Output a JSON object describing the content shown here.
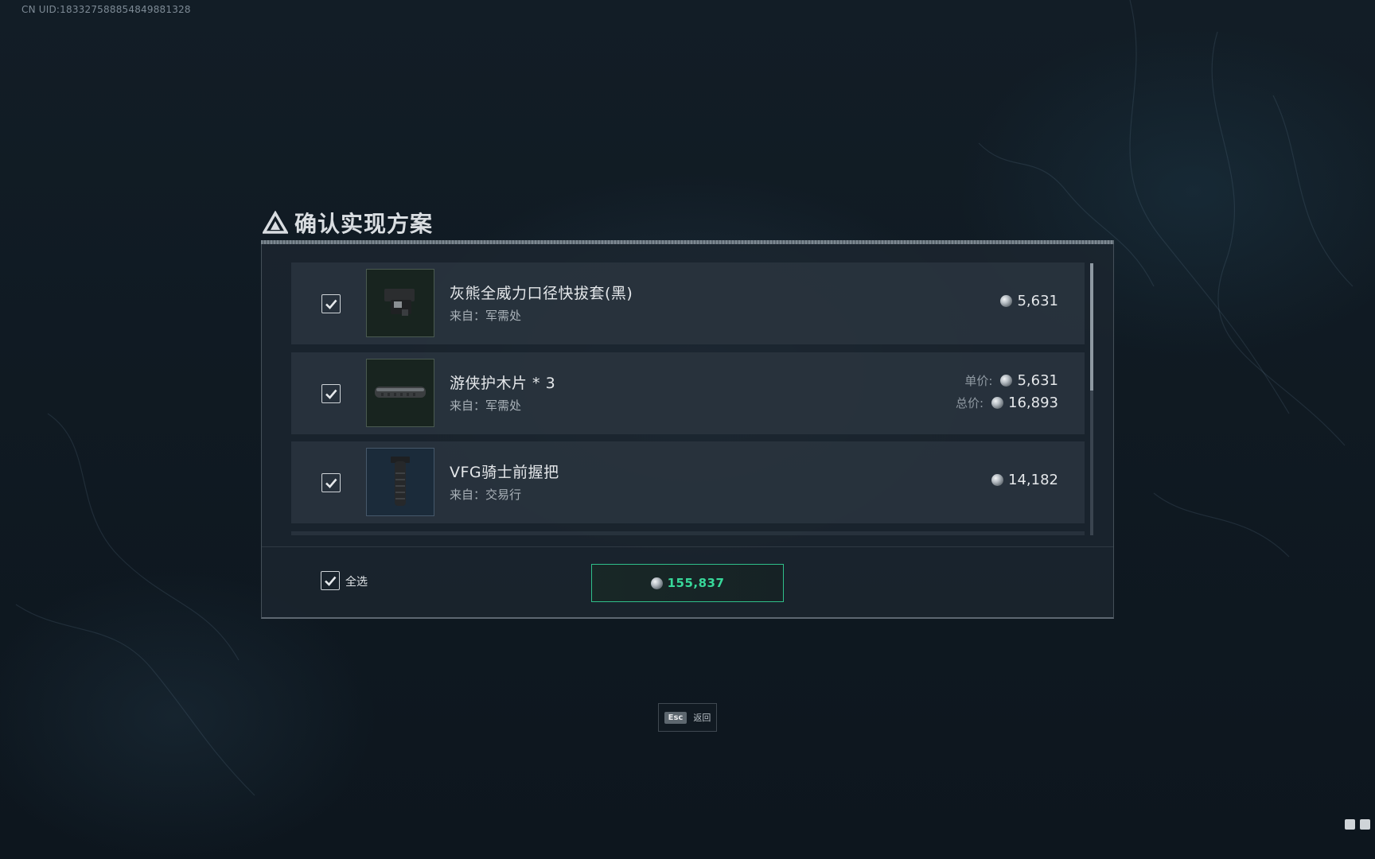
{
  "uid_text": "CN UID:1833275888548498​81328",
  "dialog": {
    "title": "确认实现方案",
    "items": [
      {
        "name": "灰熊全威力口径快拔套(黑)",
        "source": "来自：军需处",
        "checked": true,
        "price": "5,631"
      },
      {
        "name": "游侠护木片 * 3",
        "source": "来自：军需处",
        "checked": true,
        "unit_label": "单价:",
        "unit_price": "5,631",
        "total_label": "总价:",
        "total_price": "16,893"
      },
      {
        "name": "VFG骑士前握把",
        "source": "来自：交易行",
        "checked": true,
        "price": "14,182"
      }
    ],
    "select_all_label": "全选",
    "select_all_checked": true,
    "total": "155,837"
  },
  "esc": {
    "key": "Esc",
    "label": "返回"
  },
  "colors": {
    "accent_green": "#38d89a",
    "panel_bg": "#1c2630",
    "row_bg": "#2c3640"
  }
}
